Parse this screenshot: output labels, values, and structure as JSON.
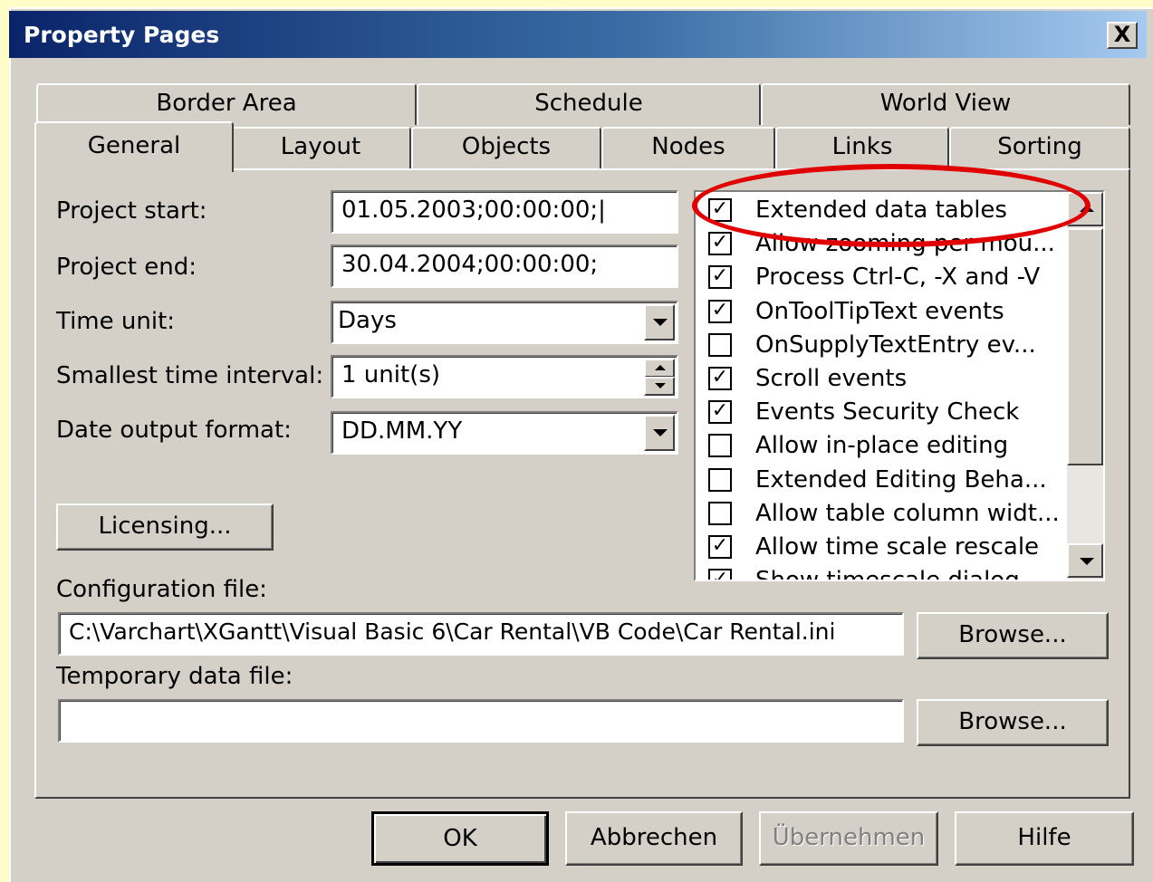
{
  "window": {
    "title": "Property Pages",
    "close_label": "X"
  },
  "tabs": {
    "row1": [
      "Border Area",
      "Schedule",
      "World View"
    ],
    "row2": [
      "General",
      "Layout",
      "Objects",
      "Nodes",
      "Links",
      "Sorting"
    ],
    "active": "General"
  },
  "general": {
    "project_start": {
      "label": "Project start:",
      "value": "01.05.2003;00:00:00;"
    },
    "project_end": {
      "label": "Project end:",
      "value": "30.04.2004;00:00:00;"
    },
    "time_unit": {
      "label": "Time unit:",
      "value": "Days"
    },
    "smallest_interval": {
      "label": "Smallest time interval:",
      "value": "1 unit(s)"
    },
    "date_format": {
      "label": "Date output format:",
      "value": "DD.MM.YY"
    },
    "licensing_button": "Licensing...",
    "config_file": {
      "label": "Configuration file:",
      "value": "C:\\Varchart\\XGantt\\Visual Basic 6\\Car Rental\\VB Code\\Car Rental.ini"
    },
    "temp_file": {
      "label": "Temporary data file:",
      "value": ""
    },
    "browse_label": "Browse..."
  },
  "options": [
    {
      "label": "Extended data tables",
      "checked": true
    },
    {
      "label": "Allow zooming per mou...",
      "checked": true
    },
    {
      "label": "Process Ctrl-C, -X and -V",
      "checked": true
    },
    {
      "label": "OnToolTipText events",
      "checked": true
    },
    {
      "label": "OnSupplyTextEntry ev...",
      "checked": false
    },
    {
      "label": "Scroll events",
      "checked": true
    },
    {
      "label": "Events Security Check",
      "checked": true
    },
    {
      "label": "Allow in-place editing",
      "checked": false
    },
    {
      "label": "Extended Editing Beha...",
      "checked": false
    },
    {
      "label": "Allow table column widt...",
      "checked": false
    },
    {
      "label": "Allow time scale rescale",
      "checked": true
    },
    {
      "label": "Show timescale dialog",
      "checked": true
    }
  ],
  "footer": {
    "ok": "OK",
    "cancel": "Abbrechen",
    "apply": "Übernehmen",
    "help": "Hilfe"
  },
  "colors": {
    "background": "#fffcc8",
    "titlebar": "#0a246a",
    "face": "#d4d0c8",
    "highlight": "#e00000"
  }
}
